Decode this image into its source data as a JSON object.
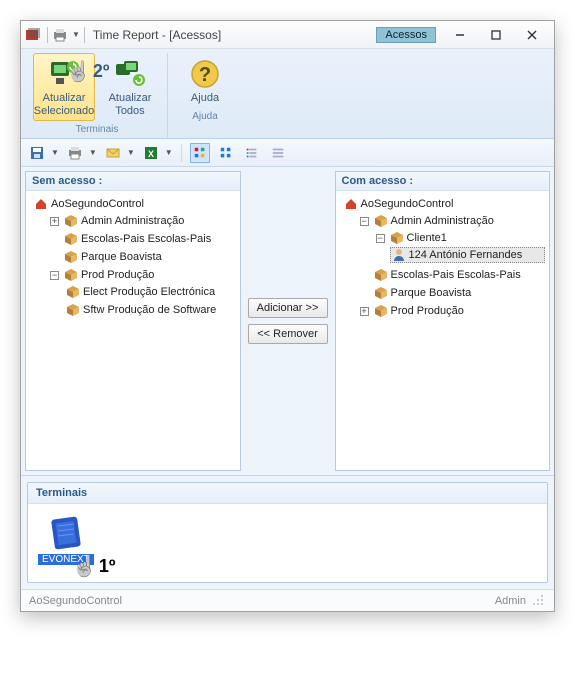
{
  "window": {
    "title": "Time Report - [Acessos]",
    "active_tab": "Acessos"
  },
  "ribbon": {
    "groups": [
      {
        "label": "Terminais",
        "buttons": [
          {
            "label": "Atualizar Selecionado",
            "selected": true
          },
          {
            "label": "Atualizar Todos",
            "selected": false
          }
        ]
      },
      {
        "label": "Ajuda",
        "buttons": [
          {
            "label": "Ajuda",
            "selected": false
          }
        ]
      }
    ]
  },
  "annotations": {
    "ribbon": "2º",
    "terminal": "1º"
  },
  "toolbar_icons": [
    "save",
    "print",
    "email",
    "excel",
    "view-icons-color",
    "view-icons",
    "view-list",
    "view-details"
  ],
  "left_panel": {
    "title": "Sem acesso :",
    "root": "AoSegundoControl",
    "nodes": [
      {
        "label": "Admin Administração",
        "expander": "+"
      },
      {
        "label": "Escolas-Pais Escolas-Pais",
        "expander": ""
      },
      {
        "label": "Parque Boavista",
        "expander": ""
      },
      {
        "label": "Prod Produção",
        "expander": "-",
        "children": [
          {
            "label": "Elect Produção Electrónica"
          },
          {
            "label": "Sftw Produção de Software"
          }
        ]
      }
    ]
  },
  "right_panel": {
    "title": "Com acesso :",
    "root": "AoSegundoControl",
    "nodes": [
      {
        "label": "Admin Administração",
        "expander": "-",
        "children": [
          {
            "label": "Cliente1",
            "expander": "-",
            "children": [
              {
                "label": "124 António Fernandes",
                "selected": true,
                "icon": "person"
              }
            ]
          }
        ]
      },
      {
        "label": "Escolas-Pais Escolas-Pais",
        "expander": ""
      },
      {
        "label": "Parque Boavista",
        "expander": ""
      },
      {
        "label": "Prod Produção",
        "expander": "+"
      }
    ]
  },
  "middle": {
    "add": "Adicionar >>",
    "remove": "<< Remover"
  },
  "terminais": {
    "title": "Terminais",
    "items": [
      {
        "label": "EVONEXT"
      }
    ]
  },
  "status": {
    "left": "AoSegundoControl",
    "right": "Admin"
  }
}
